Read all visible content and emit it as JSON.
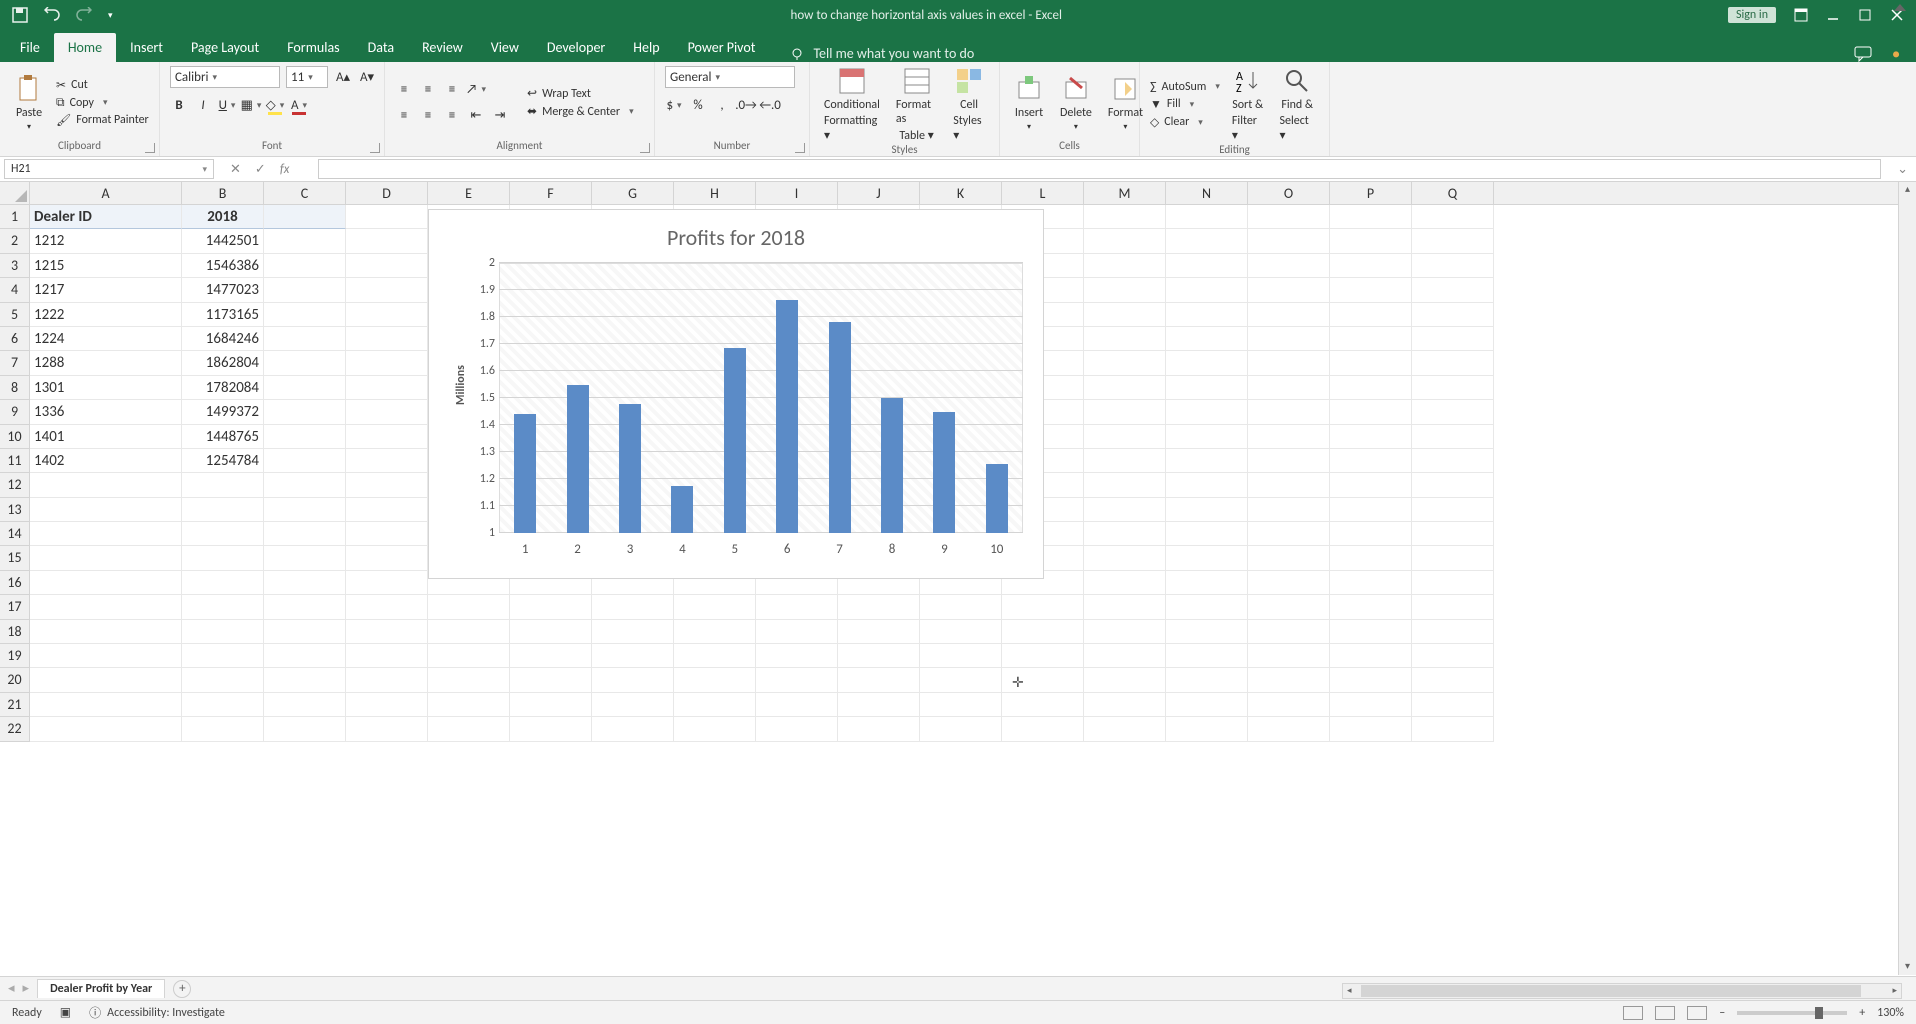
{
  "app_title": "how to change horizontal axis values in excel  -  Excel",
  "sign_in": "Sign in",
  "tabs": [
    "File",
    "Home",
    "Insert",
    "Page Layout",
    "Formulas",
    "Data",
    "Review",
    "View",
    "Developer",
    "Help",
    "Power Pivot"
  ],
  "tell_me": "Tell me what you want to do",
  "clipboard": {
    "paste": "Paste",
    "cut": "Cut",
    "copy": "Copy",
    "painter": "Format Painter",
    "label": "Clipboard"
  },
  "font": {
    "name": "Calibri",
    "size": "11",
    "label": "Font"
  },
  "alignment": {
    "wrap": "Wrap Text",
    "merge": "Merge & Center",
    "label": "Alignment"
  },
  "number": {
    "format": "General",
    "label": "Number"
  },
  "styles": {
    "cond": "Conditional",
    "cond2": "Formatting",
    "fat": "Format as",
    "fat2": "Table",
    "cell": "Cell",
    "cell2": "Styles",
    "label": "Styles"
  },
  "cells": {
    "insert": "Insert",
    "delete": "Delete",
    "format": "Format",
    "label": "Cells"
  },
  "editing": {
    "autosum": "AutoSum",
    "fill": "Fill",
    "clear": "Clear",
    "sort": "Sort &",
    "sort2": "Filter",
    "find": "Find &",
    "find2": "Select",
    "label": "Editing"
  },
  "name_box": "H21",
  "columns": [
    "A",
    "B",
    "C",
    "D",
    "E",
    "F",
    "G",
    "H",
    "I",
    "J",
    "K",
    "L",
    "M",
    "N",
    "O",
    "P",
    "Q"
  ],
  "header_row": {
    "A": "Dealer ID",
    "B": "2018"
  },
  "data_rows": [
    {
      "A": "1212",
      "B": "1442501"
    },
    {
      "A": "1215",
      "B": "1546386"
    },
    {
      "A": "1217",
      "B": "1477023"
    },
    {
      "A": "1222",
      "B": "1173165"
    },
    {
      "A": "1224",
      "B": "1684246"
    },
    {
      "A": "1288",
      "B": "1862804"
    },
    {
      "A": "1301",
      "B": "1782084"
    },
    {
      "A": "1336",
      "B": "1499372"
    },
    {
      "A": "1401",
      "B": "1448765"
    },
    {
      "A": "1402",
      "B": "1254784"
    }
  ],
  "chart_data": {
    "type": "bar",
    "title": "Profits for 2018",
    "ylabel": "Millions",
    "categories": [
      "1",
      "2",
      "3",
      "4",
      "5",
      "6",
      "7",
      "8",
      "9",
      "10"
    ],
    "values": [
      1.442501,
      1.546386,
      1.477023,
      1.173165,
      1.684246,
      1.862804,
      1.782084,
      1.499372,
      1.448765,
      1.254784
    ],
    "y_ticks": [
      "1",
      "1.1",
      "1.2",
      "1.3",
      "1.4",
      "1.5",
      "1.6",
      "1.7",
      "1.8",
      "1.9",
      "2"
    ],
    "ylim": [
      1,
      2
    ]
  },
  "sheet_tab": "Dealer Profit by Year",
  "status": {
    "ready": "Ready",
    "accessibility": "Accessibility: Investigate",
    "zoom": "130%"
  }
}
